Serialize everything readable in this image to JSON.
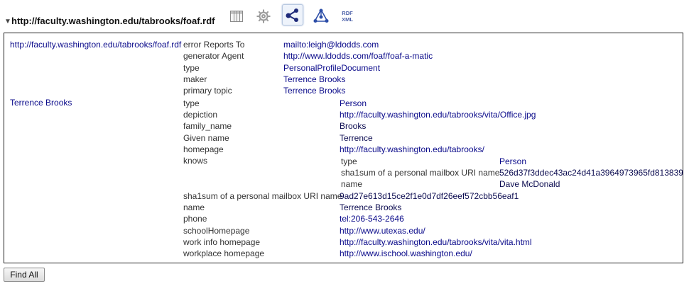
{
  "header": {
    "url": "http://faculty.washington.edu/tabrooks/foaf.rdf",
    "tools": [
      {
        "name": "table-view-icon",
        "active": false
      },
      {
        "name": "settings-icon",
        "active": false
      },
      {
        "name": "graph-view-icon",
        "active": true
      },
      {
        "name": "rdf-network-icon",
        "active": false
      },
      {
        "name": "rdf-xml-icon",
        "active": false,
        "label_top": "RDF",
        "label_bottom": "XML"
      }
    ]
  },
  "subjects": [
    {
      "name": "http://faculty.washington.edu/tabrooks/foaf.rdf",
      "properties": [
        {
          "label": "error Reports To",
          "value": "mailto:leigh@ldodds.com"
        },
        {
          "label": "generator Agent",
          "value": "http://www.ldodds.com/foaf/foaf-a-matic"
        },
        {
          "label": "type",
          "value": "PersonalProfileDocument"
        },
        {
          "label": "maker",
          "value": "Terrence Brooks"
        },
        {
          "label": "primary topic",
          "value": "Terrence Brooks"
        }
      ]
    },
    {
      "name": "Terrence Brooks",
      "properties": [
        {
          "label": "type",
          "value": "Person"
        },
        {
          "label": "depiction",
          "value": "http://faculty.washington.edu/tabrooks/vita/Office.jpg"
        },
        {
          "label": "family_name",
          "value": "Brooks"
        },
        {
          "label": "Given name",
          "value": "Terrence"
        },
        {
          "label": "homepage",
          "value": "http://faculty.washington.edu/tabrooks/"
        },
        {
          "label": "knows",
          "nested": [
            {
              "label": "type",
              "value": "Person"
            },
            {
              "label": "sha1sum of a personal mailbox URI name",
              "value": "526d37f3ddec43ac24d41a3964973965fd813839"
            },
            {
              "label": "name",
              "value": "Dave McDonald"
            }
          ]
        },
        {
          "label": "sha1sum of a personal mailbox URI name",
          "value": "9ad27e613d15ce2f1e0d7df26eef572cbb56eaf1"
        },
        {
          "label": "name",
          "value": "Terrence Brooks"
        },
        {
          "label": "phone",
          "value": "tel:206-543-2646"
        },
        {
          "label": "schoolHomepage",
          "value": "http://www.utexas.edu/"
        },
        {
          "label": "work info homepage",
          "value": "http://faculty.washington.edu/tabrooks/vita/vita.html"
        },
        {
          "label": "workplace homepage",
          "value": "http://www.ischool.washington.edu/"
        }
      ]
    }
  ],
  "footer": {
    "find_all_label": "Find All"
  }
}
